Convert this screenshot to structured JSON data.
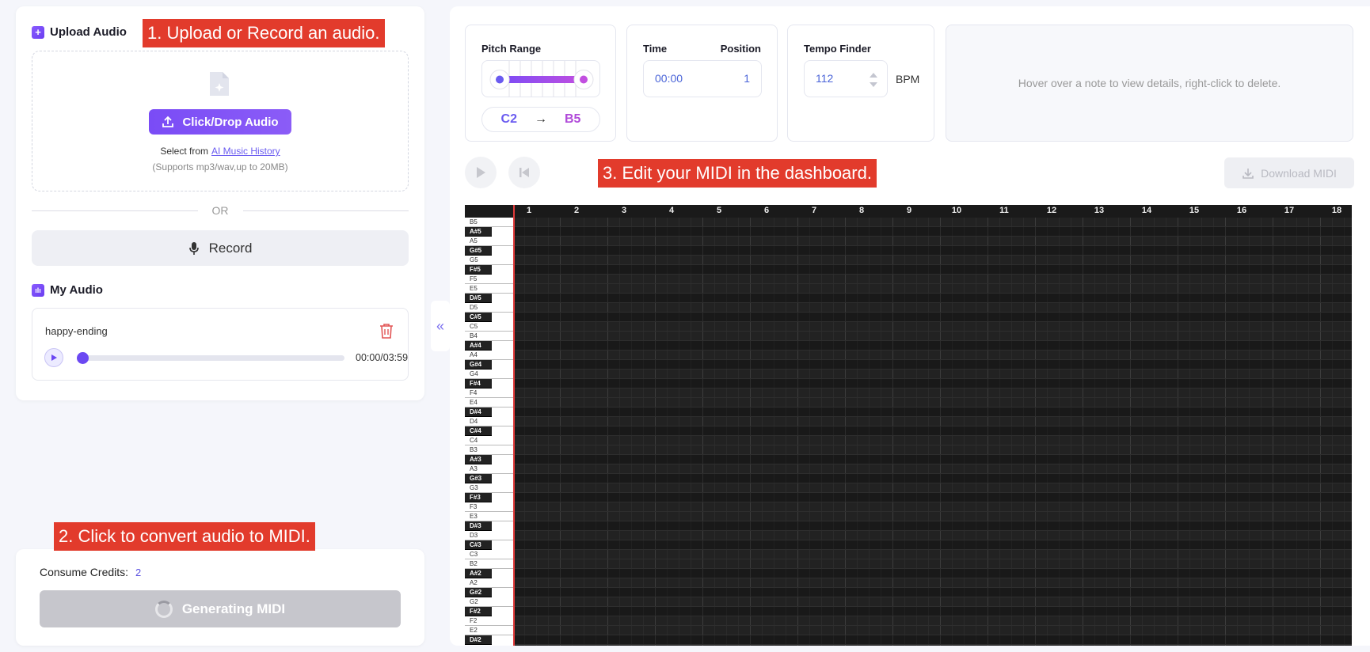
{
  "upload": {
    "title": "Upload Audio",
    "click_drop_label": "Click/Drop Audio",
    "select_from_prefix": "Select from",
    "select_from_link": "AI Music History",
    "supports": "(Supports mp3/wav,up to 20MB)",
    "or": "OR",
    "record_label": "Record"
  },
  "my_audio": {
    "title": "My Audio",
    "name": "happy-ending",
    "time": "00:00/03:59",
    "progress": 0
  },
  "credits": {
    "label": "Consume Credits:",
    "value": "2"
  },
  "generate_label": "Generating MIDI",
  "pitch_range": {
    "label": "Pitch Range",
    "low": "C2",
    "arrow": "→",
    "high": "B5"
  },
  "time_pos": {
    "time_label": "Time",
    "position_label": "Position",
    "time": "00:00",
    "position": "1"
  },
  "tempo": {
    "label": "Tempo Finder",
    "value": "112",
    "unit": "BPM"
  },
  "hint": "Hover over a note to view details, right-click to delete.",
  "download_label": "Download MIDI",
  "ruler": [
    "1",
    "2",
    "3",
    "4",
    "5",
    "6",
    "7",
    "8",
    "9",
    "10",
    "11",
    "12",
    "13",
    "14",
    "15",
    "16",
    "17",
    "18"
  ],
  "keys": [
    "B5",
    "A#5",
    "A5",
    "G#5",
    "G5",
    "F#5",
    "F5",
    "E5",
    "D#5",
    "D5",
    "C#5",
    "C5",
    "B4",
    "A#4",
    "A4",
    "G#4",
    "G4",
    "F#4",
    "F4",
    "E4",
    "D#4",
    "D4",
    "C#4",
    "C4",
    "B3",
    "A#3",
    "A3",
    "G#3",
    "G3",
    "F#3",
    "F3",
    "E3",
    "D#3",
    "D3",
    "C#3",
    "C3",
    "B2",
    "A#2",
    "A2",
    "G#2",
    "G2",
    "F#2",
    "F2",
    "E2",
    "D#2"
  ],
  "annotations": {
    "step1": "1. Upload or Record an audio.",
    "step2": "2. Click to convert audio to MIDI.",
    "step3": "3. Edit your MIDI in the dashboard."
  },
  "colors": {
    "accent": "#7a4cf6",
    "playhead": "#e03a3a",
    "annotation": "#e23b2c"
  }
}
